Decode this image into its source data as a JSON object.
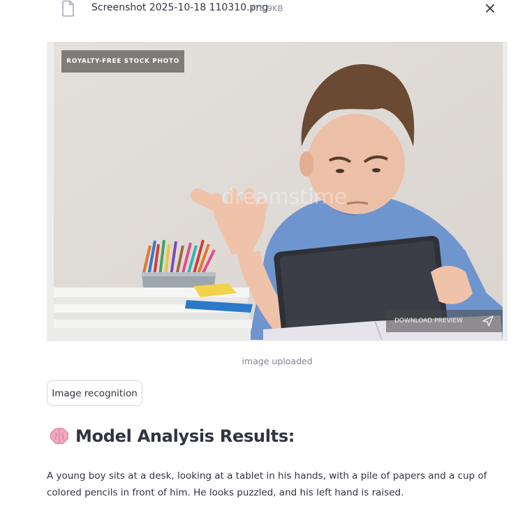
{
  "file": {
    "name": "Screenshot 2025-10-18 110310.png",
    "size": "376.9KB",
    "icon": "file-icon",
    "close_icon": "close-icon"
  },
  "image": {
    "badge": "ROYALTY-FREE STOCK PHOTO",
    "watermark": "dreamstime",
    "download_label": "DOWNLOAD PREVIEW",
    "download_icon": "send-icon",
    "caption": "image uploaded"
  },
  "button": {
    "label": "Image recognition"
  },
  "results": {
    "icon": "brain-icon",
    "heading": "Model Analysis Results:",
    "text": "A young boy sits at a desk, looking at a tablet in his hands, with a pile of papers and a cup of colored pencils in front of him. He looks puzzled, and his left hand is raised."
  },
  "colors": {
    "text": "#31333f",
    "muted": "#808495",
    "border": "#d3d5dc",
    "shirt": "#6f95cf",
    "tablet": "#35373f"
  }
}
